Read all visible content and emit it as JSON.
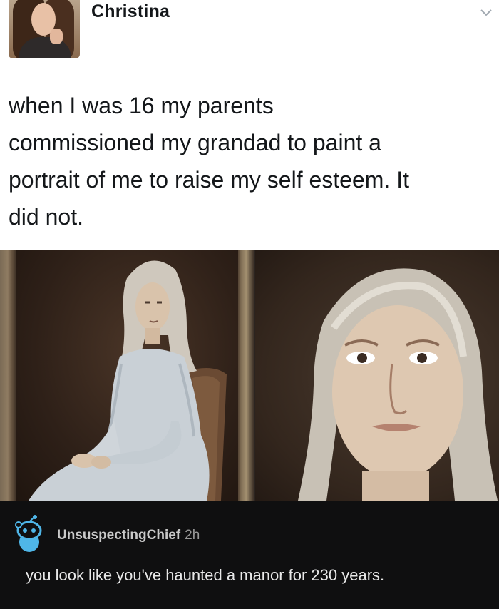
{
  "tweet": {
    "author": "Christina",
    "text": "when I was 16 my parents commissioned my grandad to paint a portrait of me to raise my self esteem. It did not.",
    "text_lines": [
      "when I was 16 my parents",
      "commissioned my grandad to paint a",
      "portrait of me to raise my self esteem. It",
      "did not."
    ],
    "menu_icon": "chevron-down-icon",
    "avatar_icon": "avatar"
  },
  "media": {
    "left_image": "painting-full-portrait",
    "right_image": "painting-closeup-face"
  },
  "comment": {
    "username": "UnsuspectingChief",
    "time": "2h",
    "text": "you look like you've haunted a manor for 230 years.",
    "avatar_icon": "snoo-avatar-icon",
    "accent_color": "#4fb6e8"
  }
}
